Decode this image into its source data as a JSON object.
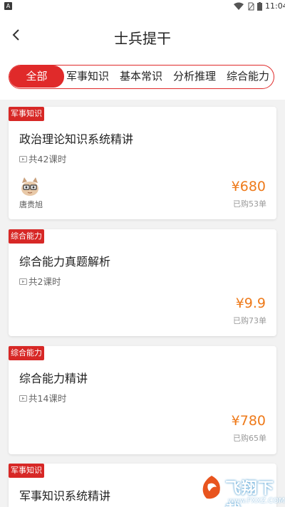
{
  "status_bar": {
    "time": "11:04",
    "app_indicator": "A"
  },
  "header": {
    "title": "士兵提干",
    "back_icon": "chevron-left-icon"
  },
  "tabs": [
    {
      "label": "全部",
      "active": true
    },
    {
      "label": "军事知识",
      "active": false
    },
    {
      "label": "基本常识",
      "active": false
    },
    {
      "label": "分析推理",
      "active": false
    },
    {
      "label": "综合能力",
      "active": false
    }
  ],
  "courses": [
    {
      "category": "军事知识",
      "title": "政治理论知识系统精讲",
      "lessons": "共42课时",
      "teacher": "唐贵旭",
      "price": "¥680",
      "sold": "已购53单"
    },
    {
      "category": "综合能力",
      "title": "综合能力真题解析",
      "lessons": "共2课时",
      "price": "¥9.9",
      "sold": "已购73单"
    },
    {
      "category": "综合能力",
      "title": "综合能力精讲",
      "lessons": "共14课时",
      "price": "¥780",
      "sold": "已购65单"
    },
    {
      "category": "军事知识",
      "title": "军事知识系统精讲"
    }
  ],
  "watermark": {
    "brand": "飞翔下载",
    "url": "www.FXXZ.COM"
  },
  "colors": {
    "accent": "#e02a2a",
    "tag": "#d72826",
    "price": "#ee7a1a",
    "background": "#f2f2f2"
  }
}
